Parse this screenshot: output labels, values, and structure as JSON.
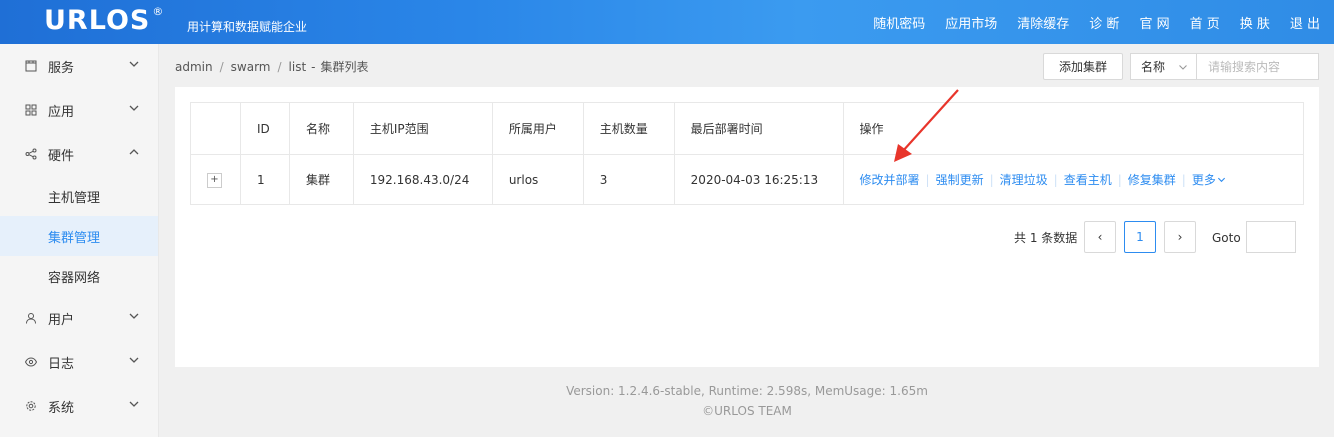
{
  "header": {
    "logo": "URLOS",
    "logo_mark": "®",
    "slogan": "用计算和数据赋能企业",
    "nav": [
      "随机密码",
      "应用市场",
      "清除缓存",
      "诊 断",
      "官 网",
      "首 页",
      "换 肤",
      "退 出"
    ]
  },
  "sidebar": {
    "items": [
      {
        "label": "服务"
      },
      {
        "label": "应用"
      },
      {
        "label": "硬件"
      },
      {
        "label": "主机管理"
      },
      {
        "label": "集群管理"
      },
      {
        "label": "容器网络"
      },
      {
        "label": "用户"
      },
      {
        "label": "日志"
      },
      {
        "label": "系统"
      }
    ]
  },
  "breadcrumb": {
    "p1": "admin",
    "sep": "/",
    "p2": "swarm",
    "p3": "list",
    "dash": "-",
    "current": "集群列表"
  },
  "toolbar": {
    "add_label": "添加集群",
    "select_value": "名称",
    "search_placeholder": "请输搜索内容"
  },
  "table": {
    "headers": [
      "ID",
      "名称",
      "主机IP范围",
      "所属用户",
      "主机数量",
      "最后部署时间",
      "操作"
    ],
    "rows": [
      {
        "expand": "+",
        "id": "1",
        "name": "集群",
        "ip": "192.168.43.0/24",
        "user": "urlos",
        "count": "3",
        "time": "2020-04-03 16:25:13"
      }
    ],
    "actions": [
      "修改并部署",
      "强制更新",
      "清理垃圾",
      "查看主机",
      "修复集群",
      "更多"
    ]
  },
  "pagination": {
    "total": "共 1 条数据",
    "prev": "‹",
    "current": "1",
    "next": "›",
    "goto": "Goto"
  },
  "footer": {
    "line1": "Version: 1.2.4.6-stable,    Runtime: 2.598s,    MemUsage: 1.65m",
    "line2": "©URLOS TEAM"
  },
  "colors": {
    "header_blue": "#2a86e8",
    "link_blue": "#2d8cf0",
    "active_bg": "#e6f0fb",
    "annotation_arrow": "#e8352b"
  },
  "icons": [
    "service-icon",
    "apps-icon",
    "hardware-icon",
    "user-icon",
    "eye-icon",
    "gear-icon",
    "chevron-down-icon",
    "chevron-up-icon"
  ]
}
